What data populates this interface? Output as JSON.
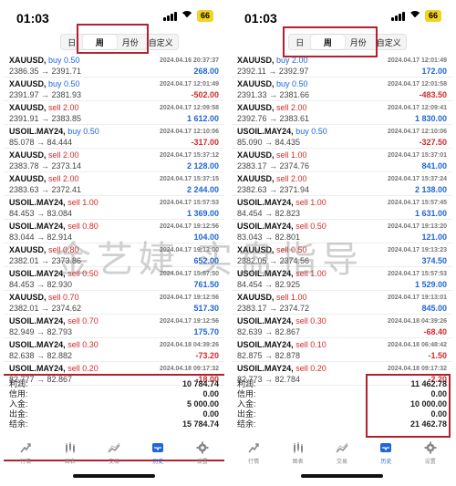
{
  "colors": {
    "accent": "#1f66d8",
    "loss": "#d32a2a",
    "highlight": "#b3212c",
    "battery": "#f2d321"
  },
  "watermark": "金艺婕 实盘指导",
  "phones": [
    {
      "status": {
        "time": "01:03",
        "battery": "66"
      },
      "segments": [
        {
          "label": "日",
          "active": false
        },
        {
          "label": "周",
          "active": true
        },
        {
          "label": "月份",
          "active": false
        },
        {
          "label": "自定义",
          "active": false
        }
      ],
      "trades": [
        {
          "symbol": "XAUUSD,",
          "action": "buy 0.50",
          "side": "buy",
          "time": "2024.04.16 20:37:37",
          "prices": "2386.35 → 2391.71",
          "profit": "268.00"
        },
        {
          "symbol": "XAUUSD,",
          "action": "buy 0.50",
          "side": "buy",
          "time": "2024.04.17 12:01:49",
          "prices": "2391.97 → 2381.93",
          "profit": "-502.00"
        },
        {
          "symbol": "XAUUSD,",
          "action": "sell 2.00",
          "side": "sell",
          "time": "2024.04.17 12:09:58",
          "prices": "2391.91 → 2383.85",
          "profit": "1 612.00"
        },
        {
          "symbol": "USOIL.MAY24,",
          "action": "buy 0.50",
          "side": "buy",
          "time": "2024.04.17 12:10:06",
          "prices": "85.078 → 84.444",
          "profit": "-317.00"
        },
        {
          "symbol": "XAUUSD,",
          "action": "sell 2.00",
          "side": "sell",
          "time": "2024.04.17 15:37:12",
          "prices": "2383.78 → 2373.14",
          "profit": "2 128.00"
        },
        {
          "symbol": "XAUUSD,",
          "action": "sell 2.00",
          "side": "sell",
          "time": "2024.04.17 15:37:15",
          "prices": "2383.63 → 2372.41",
          "profit": "2 244.00"
        },
        {
          "symbol": "USOIL.MAY24,",
          "action": "sell 1.00",
          "side": "sell",
          "time": "2024.04.17 15:57:53",
          "prices": "84.453 → 83.084",
          "profit": "1 369.00"
        },
        {
          "symbol": "USOIL.MAY24,",
          "action": "sell 0.80",
          "side": "sell",
          "time": "2024.04.17 19:12:56",
          "prices": "83.044 → 82.914",
          "profit": "104.00"
        },
        {
          "symbol": "XAUUSD,",
          "action": "sell 0.80",
          "side": "sell",
          "time": "2024.04.17 19:13:00",
          "prices": "2382.01 → 2373.86",
          "profit": "652.00"
        },
        {
          "symbol": "USOIL.MAY24,",
          "action": "sell 0.50",
          "side": "sell",
          "time": "2024.04.17 15:57:50",
          "prices": "84.453 → 82.930",
          "profit": "761.50"
        },
        {
          "symbol": "XAUUSD,",
          "action": "sell 0.70",
          "side": "sell",
          "time": "2024.04.17 19:12:56",
          "prices": "2382.01 → 2374.62",
          "profit": "517.30"
        },
        {
          "symbol": "USOIL.MAY24,",
          "action": "sell 0.70",
          "side": "sell",
          "time": "2024.04.17 19:12:56",
          "prices": "82.949 → 82.793",
          "profit": "175.70"
        },
        {
          "symbol": "USOIL.MAY24,",
          "action": "sell 0.30",
          "side": "sell",
          "time": "2024.04.18 04:39:26",
          "prices": "82.638 → 82.882",
          "profit": "-73.20"
        },
        {
          "symbol": "USOIL.MAY24,",
          "action": "sell 0.20",
          "side": "sell",
          "time": "2024.04.18 09:17:32",
          "prices": "82.777 → 82.867",
          "profit": "-18.00"
        }
      ],
      "summary": [
        {
          "label": "利润:",
          "value": "10 784.74"
        },
        {
          "label": "信用:",
          "value": "0.00"
        },
        {
          "label": "入金:",
          "value": "5 000.00"
        },
        {
          "label": "出金:",
          "value": "0.00"
        },
        {
          "label": "结余:",
          "value": "15 784.74"
        }
      ],
      "tabs": [
        {
          "label": "行情",
          "icon": "quotes-icon",
          "active": false
        },
        {
          "label": "图表",
          "icon": "chart-icon",
          "active": false
        },
        {
          "label": "交易",
          "icon": "trade-icon",
          "active": false
        },
        {
          "label": "历史",
          "icon": "history-icon",
          "active": true
        },
        {
          "label": "设置",
          "icon": "settings-icon",
          "active": false
        }
      ]
    },
    {
      "status": {
        "time": "01:03",
        "battery": "66"
      },
      "segments": [
        {
          "label": "日",
          "active": false
        },
        {
          "label": "周",
          "active": true
        },
        {
          "label": "月份",
          "active": false
        },
        {
          "label": "自定义",
          "active": false
        }
      ],
      "trades": [
        {
          "symbol": "XAUUSD,",
          "action": "buy 2.00",
          "side": "buy",
          "time": "2024.04.17 12:01:49",
          "prices": "2392.11 → 2392.97",
          "profit": "172.00"
        },
        {
          "symbol": "XAUUSD,",
          "action": "buy 0.50",
          "side": "buy",
          "time": "2024.04.17 12:01:58",
          "prices": "2391.33 → 2381.66",
          "profit": "-483.50"
        },
        {
          "symbol": "XAUUSD,",
          "action": "sell 2.00",
          "side": "sell",
          "time": "2024.04.17 12:09:41",
          "prices": "2392.76 → 2383.61",
          "profit": "1 830.00"
        },
        {
          "symbol": "USOIL.MAY24,",
          "action": "buy 0.50",
          "side": "buy",
          "time": "2024.04.17 12:10:06",
          "prices": "85.090 → 84.435",
          "profit": "-327.50"
        },
        {
          "symbol": "XAUUSD,",
          "action": "sell 1.00",
          "side": "sell",
          "time": "2024.04.17 15:37:01",
          "prices": "2383.17 → 2374.76",
          "profit": "841.00"
        },
        {
          "symbol": "XAUUSD,",
          "action": "sell 2.00",
          "side": "sell",
          "time": "2024.04.17 15:37:24",
          "prices": "2382.63 → 2371.94",
          "profit": "2 138.00"
        },
        {
          "symbol": "USOIL.MAY24,",
          "action": "sell 1.00",
          "side": "sell",
          "time": "2024.04.17 15:57:45",
          "prices": "84.454 → 82.823",
          "profit": "1 631.00"
        },
        {
          "symbol": "USOIL.MAY24,",
          "action": "sell 0.50",
          "side": "sell",
          "time": "2024.04.17 19:13:20",
          "prices": "83.043 → 82.801",
          "profit": "121.00"
        },
        {
          "symbol": "XAUUSD,",
          "action": "sell 0.50",
          "side": "sell",
          "time": "2024.04.17 19:13:23",
          "prices": "2382.05 → 2374.56",
          "profit": "374.50"
        },
        {
          "symbol": "USOIL.MAY24,",
          "action": "sell 1.00",
          "side": "sell",
          "time": "2024.04.17 15:57:53",
          "prices": "84.454 → 82.925",
          "profit": "1 529.00"
        },
        {
          "symbol": "XAUUSD,",
          "action": "sell 1.00",
          "side": "sell",
          "time": "2024.04.17 19:13:01",
          "prices": "2383.17 → 2374.72",
          "profit": "845.00"
        },
        {
          "symbol": "USOIL.MAY24,",
          "action": "sell 0.30",
          "side": "sell",
          "time": "2024.04.18 04:39:26",
          "prices": "82.639 → 82.867",
          "profit": "-68.40"
        },
        {
          "symbol": "USOIL.MAY24,",
          "action": "sell 0.10",
          "side": "sell",
          "time": "2024.04.18 06:48:42",
          "prices": "82.875 → 82.878",
          "profit": "-1.50"
        },
        {
          "symbol": "USOIL.MAY24,",
          "action": "sell 0.20",
          "side": "sell",
          "time": "2024.04.18 09:17:32",
          "prices": "82.773 → 82.784",
          "profit": "-2.20"
        }
      ],
      "summary": [
        {
          "label": "利润:",
          "value": "11 462.78"
        },
        {
          "label": "信用:",
          "value": "0.00"
        },
        {
          "label": "入金:",
          "value": "10 000.00"
        },
        {
          "label": "出金:",
          "value": "0.00"
        },
        {
          "label": "结余:",
          "value": "21 462.78"
        }
      ],
      "tabs": [
        {
          "label": "行情",
          "icon": "quotes-icon",
          "active": false
        },
        {
          "label": "图表",
          "icon": "chart-icon",
          "active": false
        },
        {
          "label": "交易",
          "icon": "trade-icon",
          "active": false
        },
        {
          "label": "历史",
          "icon": "history-icon",
          "active": true
        },
        {
          "label": "设置",
          "icon": "settings-icon",
          "active": false
        }
      ]
    }
  ]
}
